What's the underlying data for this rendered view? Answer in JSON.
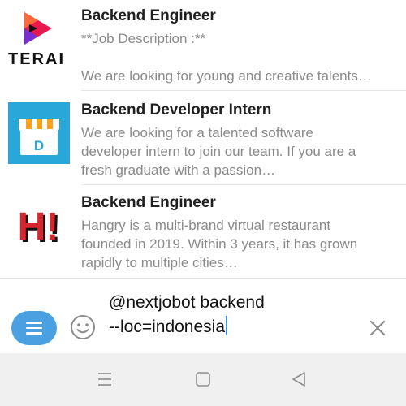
{
  "results": [
    {
      "title": "Backend Engineer",
      "desc1": "**Job Description :**",
      "desc2": "",
      "desc3": "We are looking for young and creative talents…",
      "logo_icon": "terra-logo",
      "logo_text": "TERAI"
    },
    {
      "title": "Backend Developer Intern",
      "desc1": "We are looking for a talented software",
      "desc2": "developer intern to join our team. If you are a",
      "desc3": "fresh graduate with a passion…",
      "logo_icon": "storefront-logo",
      "logo_text": "D"
    },
    {
      "title": "Backend Engineer",
      "desc1": "Hangry is a multi-brand virtual restaurant",
      "desc2": "founded in 2019. Within 3 years, it has grown",
      "desc3": "rapidly to multiple cities…",
      "logo_icon": "hangry-logo",
      "logo_text": "H!"
    }
  ],
  "compose": {
    "input_line1": "@nextjobot backend",
    "input_line2": "--loc=indonesia",
    "menu_icon": "hamburger-icon",
    "emoji_icon": "smiley-icon",
    "clear_icon": "close-icon",
    "accent_color": "#4aa0e0"
  },
  "navbar": {
    "icons": [
      "recents-icon",
      "home-icon",
      "back-icon"
    ]
  }
}
